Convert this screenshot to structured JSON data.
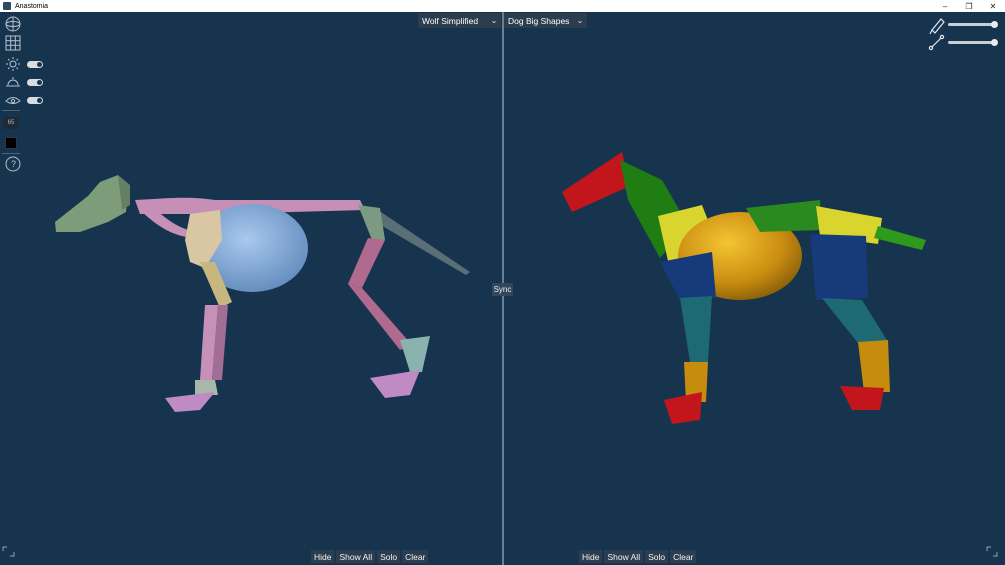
{
  "window": {
    "title": "Anastomia",
    "minimize_glyph": "–",
    "maximize_glyph": "❐",
    "close_glyph": "✕"
  },
  "left_viewport": {
    "model_select": {
      "value": "Wolf Simplified"
    },
    "actions": {
      "hide": "Hide",
      "show_all": "Show All",
      "solo": "Solo",
      "clear": "Clear"
    }
  },
  "right_viewport": {
    "model_select": {
      "value": "Dog Big Shapes"
    },
    "actions": {
      "hide": "Hide",
      "show_all": "Show All",
      "solo": "Solo",
      "clear": "Clear"
    }
  },
  "sync": {
    "label": "Sync"
  },
  "toolbar": {
    "field_value": "65",
    "light_toggle_on": true,
    "horizon_toggle_on": true,
    "visibility_toggle_on": true,
    "help_glyph": "?"
  },
  "sliders": {
    "brush_level": 1.0,
    "bone_level": 1.0
  },
  "colors": {
    "background": "#17344f",
    "panel": "#2b3d4e",
    "divider": "#6a7f92"
  },
  "icons": [
    "sphere-icon",
    "grid-icon",
    "light-icon",
    "horizon-icon",
    "eye-icon",
    "help-icon",
    "brush-icon",
    "bone-icon",
    "expand-icon"
  ]
}
